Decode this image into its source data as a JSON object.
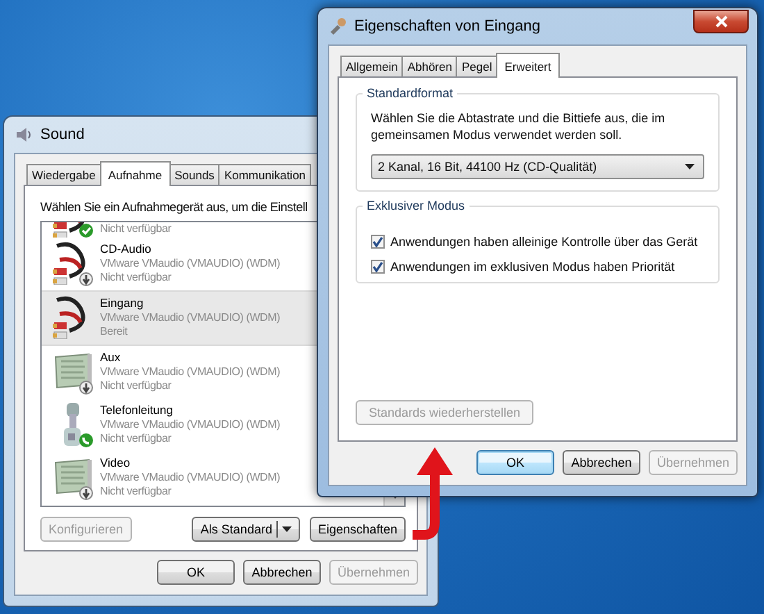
{
  "sound_window": {
    "title": "Sound",
    "active": false,
    "tabs": [
      {
        "label": "Wiedergabe",
        "selected": false
      },
      {
        "label": "Aufnahme",
        "selected": true
      },
      {
        "label": "Sounds",
        "selected": false
      },
      {
        "label": "Kommunikation",
        "selected": false
      }
    ],
    "description": "Wählen Sie ein Aufnahmegerät aus, um die Einstell",
    "devices": [
      {
        "kind": "cable",
        "default_device": true,
        "unplugged": false,
        "default_communication": false,
        "status": "Nicht verfügbar",
        "selected": false
      },
      {
        "kind": "cable",
        "default_device": false,
        "unplugged": true,
        "default_communication": false,
        "name": "CD-Audio",
        "driver": "VMware VMaudio (VMAUDIO) (WDM)",
        "status": "Nicht verfügbar",
        "selected": false
      },
      {
        "kind": "cable",
        "default_device": false,
        "unplugged": false,
        "default_communication": false,
        "name": "Eingang",
        "driver": "VMware VMaudio (VMAUDIO) (WDM)",
        "status": "Bereit",
        "selected": true
      },
      {
        "kind": "card",
        "default_device": false,
        "unplugged": true,
        "default_communication": false,
        "name": "Aux",
        "driver": "VMware VMaudio (VMAUDIO) (WDM)",
        "status": "Nicht verfügbar",
        "selected": false
      },
      {
        "kind": "phone",
        "default_device": false,
        "unplugged": false,
        "default_communication": true,
        "name": "Telefonleitung",
        "driver": "VMware VMaudio (VMAUDIO) (WDM)",
        "status": "Nicht verfügbar",
        "selected": false
      },
      {
        "kind": "card",
        "default_device": false,
        "unplugged": true,
        "default_communication": false,
        "name": "Video",
        "driver": "VMware VMaudio (VMAUDIO) (WDM)",
        "status": "Nicht verfügbar",
        "selected": false
      }
    ],
    "buttons": [
      {
        "label": "Konfigurieren",
        "kind": "plain",
        "disabled": true
      },
      {
        "label": "Als Standard",
        "kind": "split",
        "disabled": false
      },
      {
        "label": "Eigenschaften",
        "kind": "plain",
        "disabled": false
      }
    ],
    "footer_buttons": [
      {
        "label": "OK",
        "default": false,
        "disabled": false
      },
      {
        "label": "Abbrechen",
        "default": false,
        "disabled": false
      },
      {
        "label": "Übernehmen",
        "default": false,
        "disabled": true
      }
    ]
  },
  "properties_window": {
    "title": "Eigenschaften von Eingang",
    "active": true,
    "tabs": [
      {
        "label": "Allgemein",
        "selected": false
      },
      {
        "label": "Abhören",
        "selected": false
      },
      {
        "label": "Pegel",
        "selected": false
      },
      {
        "label": "Erweitert",
        "selected": true
      }
    ],
    "standard_format": {
      "title": "Standardformat",
      "description": "Wählen Sie die Abtastrate und die Bittiefe aus, die im gemeinsamen Modus verwendet werden soll.",
      "value": "2 Kanal, 16 Bit, 44100 Hz (CD-Qualität)"
    },
    "exclusive_mode": {
      "title": "Exklusiver Modus",
      "options": [
        {
          "label": "Anwendungen haben alleinige Kontrolle über das Gerät",
          "checked": true
        },
        {
          "label": "Anwendungen im exklusiven Modus haben Priorität",
          "checked": true
        }
      ]
    },
    "restore_button": {
      "label": "Standards wiederherstellen",
      "disabled": true
    },
    "footer_buttons": [
      {
        "label": "OK",
        "default": true,
        "disabled": false
      },
      {
        "label": "Abbrechen",
        "default": false,
        "disabled": false
      },
      {
        "label": "Übernehmen",
        "default": false,
        "disabled": true
      }
    ]
  }
}
